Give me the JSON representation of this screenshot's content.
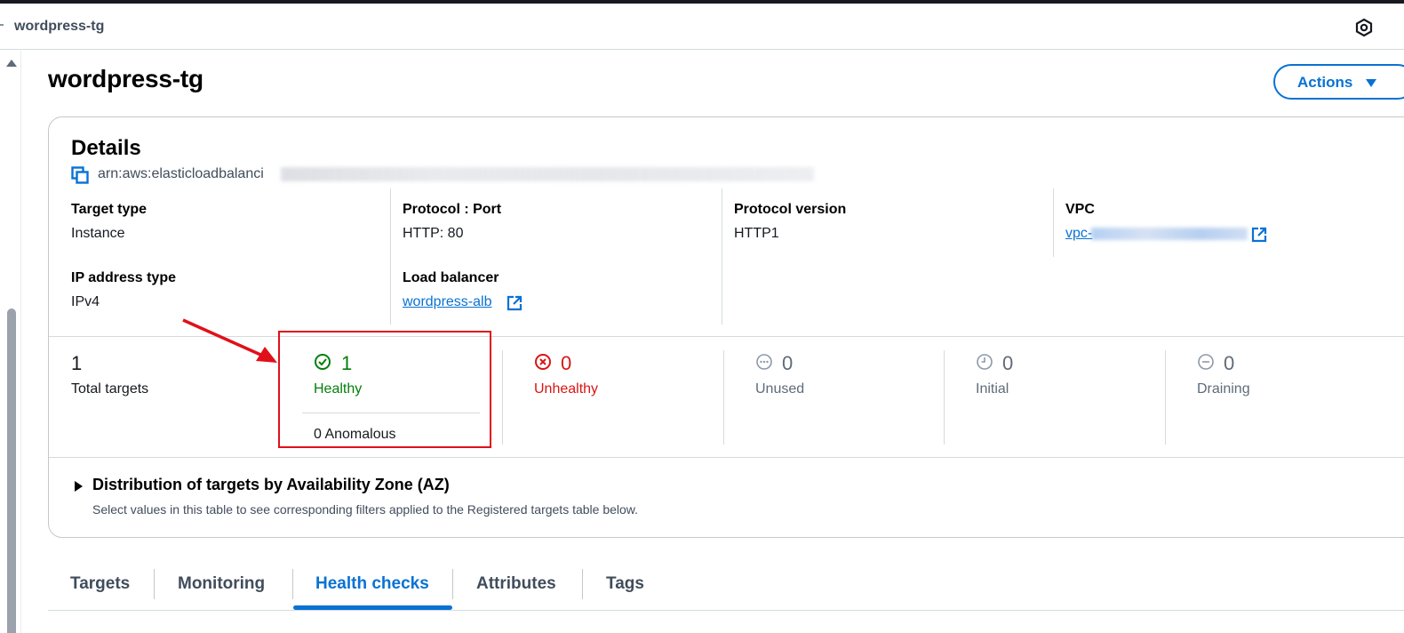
{
  "header": {
    "breadcrumb": "wordpress-tg",
    "icon": "hexagon-settings-icon"
  },
  "page": {
    "title": "wordpress-tg",
    "actions_label": "Actions"
  },
  "details": {
    "title": "Details",
    "arn_prefix": "arn:aws:elasticloadbalanci",
    "fields": {
      "target_type_label": "Target type",
      "target_type_value": "Instance",
      "protocol_port_label": "Protocol : Port",
      "protocol_port_value": "HTTP: 80",
      "protocol_version_label": "Protocol version",
      "protocol_version_value": "HTTP1",
      "vpc_label": "VPC",
      "vpc_value": "vpc-",
      "ip_address_type_label": "IP address type",
      "ip_address_type_value": "IPv4",
      "load_balancer_label": "Load balancer",
      "load_balancer_value": "wordpress-alb"
    }
  },
  "targets_summary": {
    "total": {
      "value": "1",
      "label": "Total targets"
    },
    "healthy": {
      "value": "1",
      "label": "Healthy",
      "anomalous": "0 Anomalous"
    },
    "unhealthy": {
      "value": "0",
      "label": "Unhealthy"
    },
    "unused": {
      "value": "0",
      "label": "Unused"
    },
    "initial": {
      "value": "0",
      "label": "Initial"
    },
    "draining": {
      "value": "0",
      "label": "Draining"
    }
  },
  "distribution": {
    "title": "Distribution of targets by Availability Zone (AZ)",
    "description": "Select values in this table to see corresponding filters applied to the Registered targets table below."
  },
  "tabs": [
    {
      "label": "Targets"
    },
    {
      "label": "Monitoring"
    },
    {
      "label": "Health checks"
    },
    {
      "label": "Attributes"
    },
    {
      "label": "Tags"
    }
  ],
  "active_tab": "Health checks",
  "colors": {
    "accent": "#0972d3",
    "healthy": "#037f0c",
    "unhealthy": "#d91515",
    "annotation": "#e0101a"
  }
}
